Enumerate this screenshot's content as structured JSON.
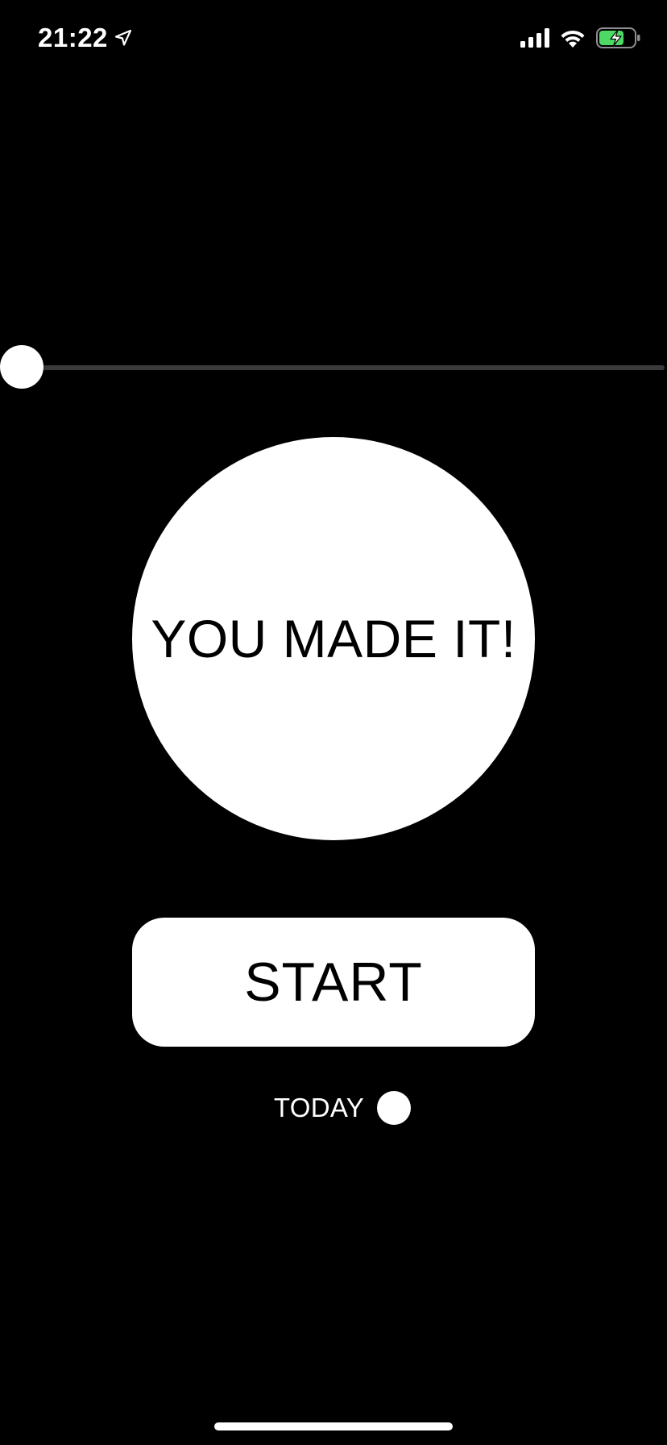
{
  "status_bar": {
    "time": "21:22",
    "icons": [
      "location-arrow-icon",
      "cellular-signal-icon",
      "wifi-icon",
      "battery-charging-icon"
    ],
    "battery_color": "#4cd964"
  },
  "slider": {
    "value": 0.0
  },
  "main": {
    "circle_text": "YOU MADE IT!",
    "start_label": "START",
    "today_label": "TODAY"
  },
  "colors": {
    "background": "#000000",
    "foreground": "#ffffff",
    "track": "#3a3a3c"
  }
}
